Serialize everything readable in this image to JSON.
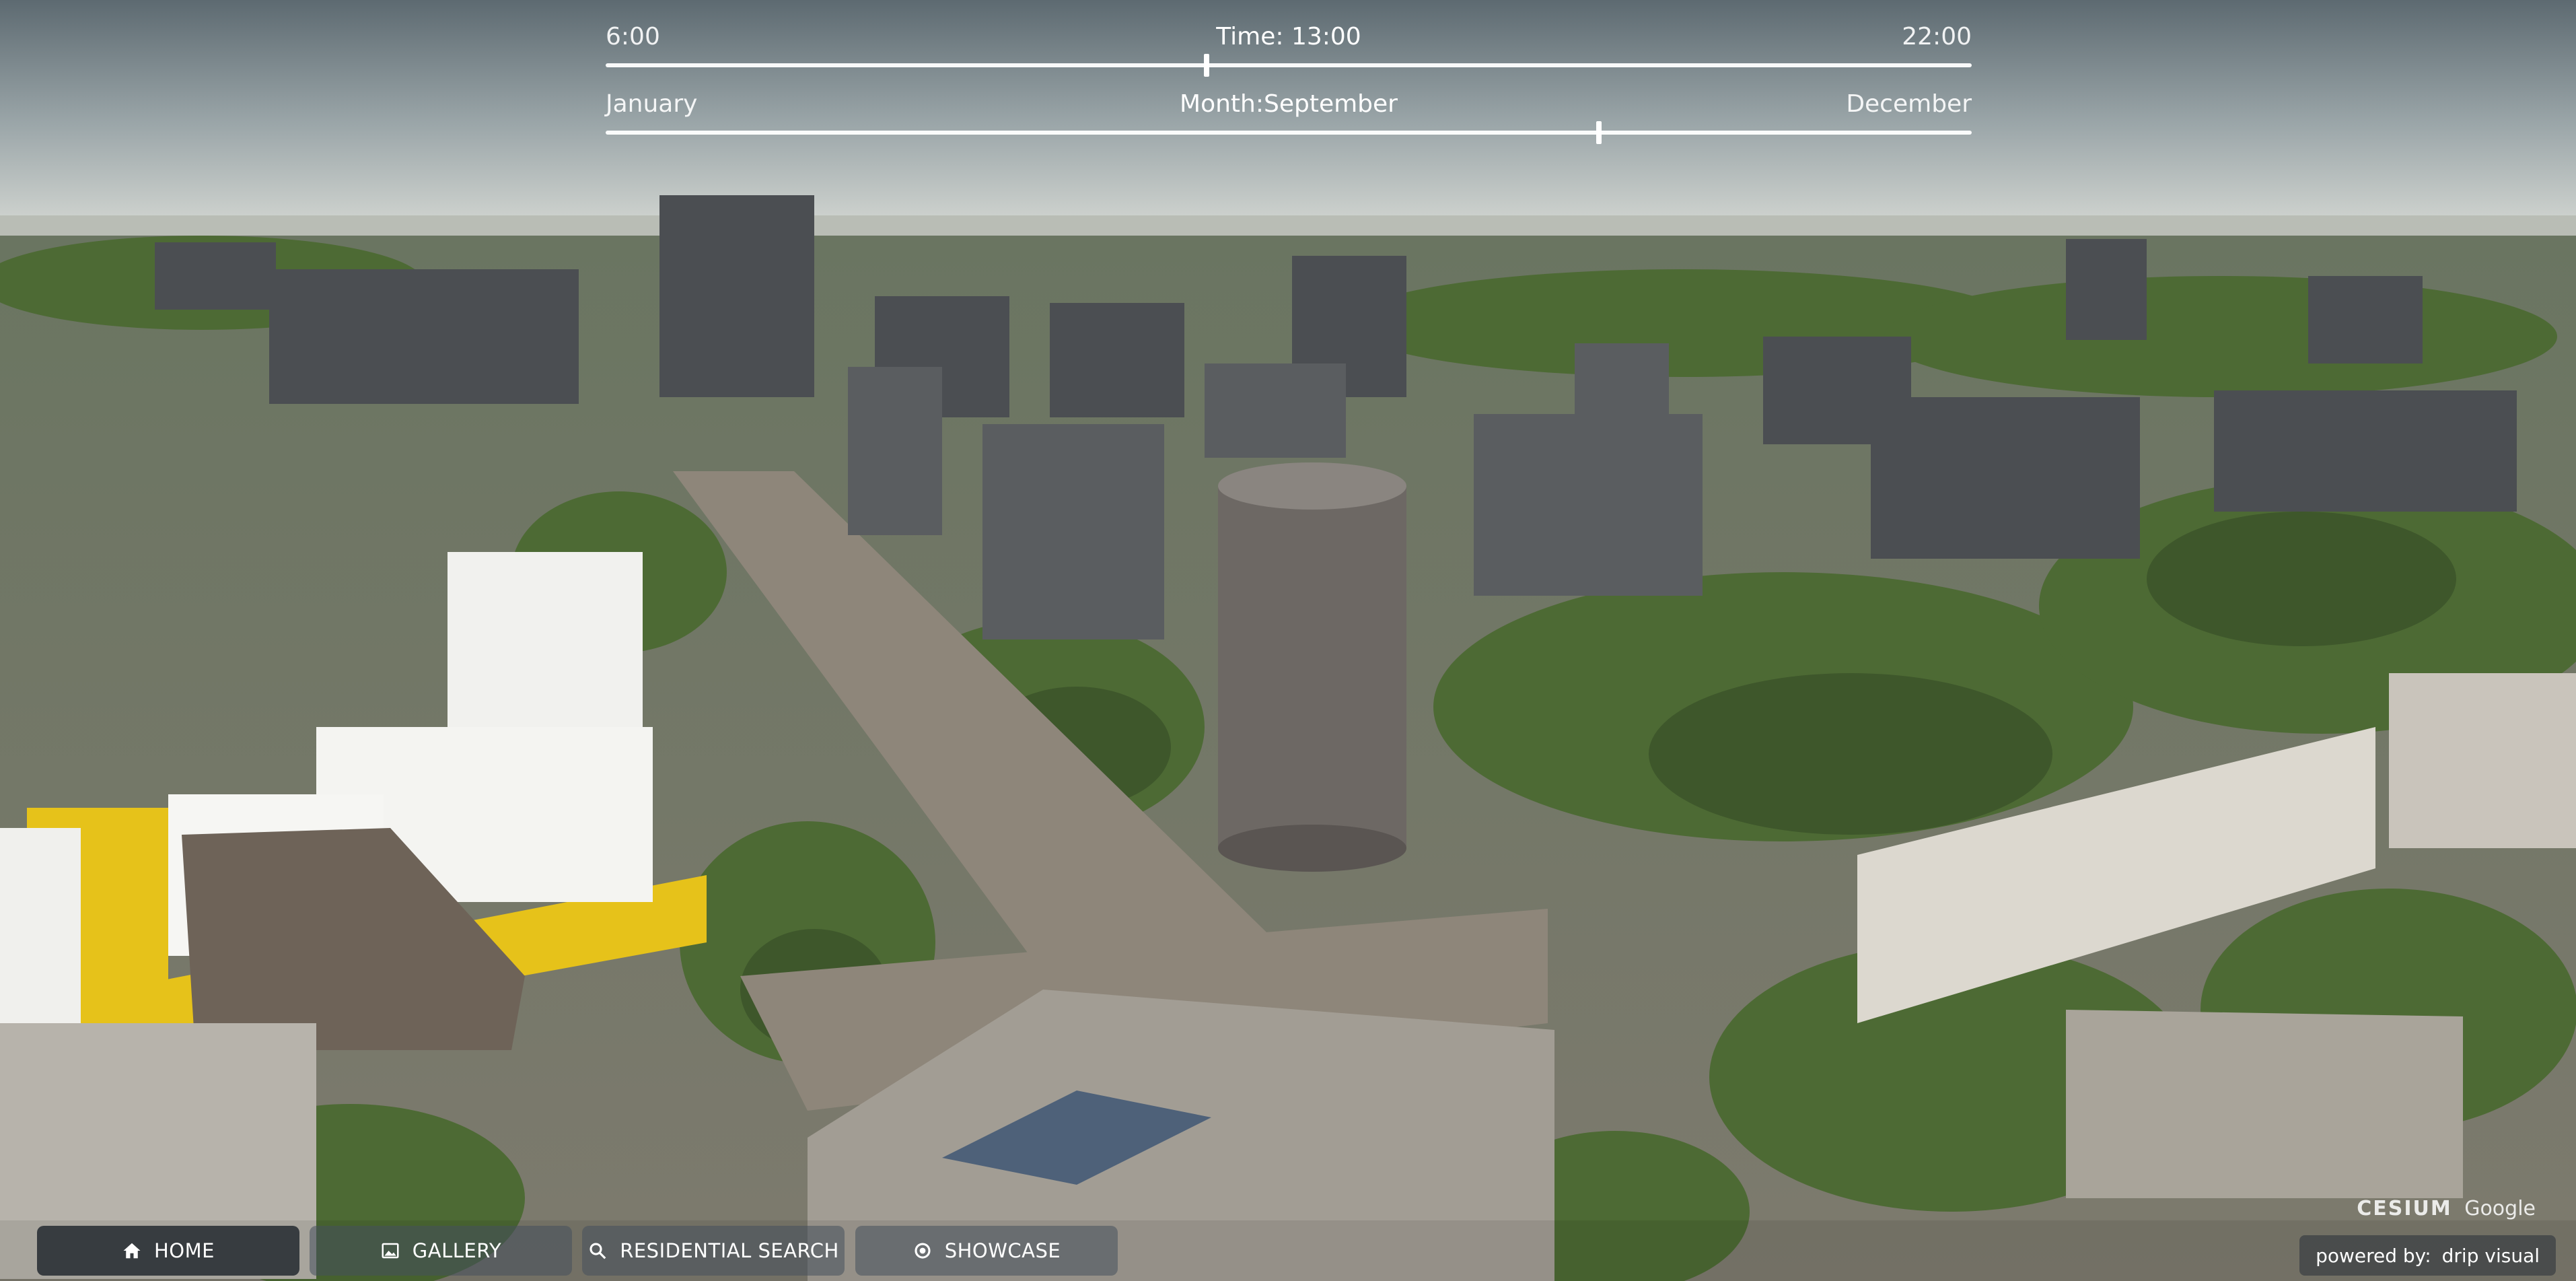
{
  "time_slider": {
    "min_label": "6:00",
    "current_label": "Time: 13:00",
    "max_label": "22:00",
    "value_fraction": 0.44
  },
  "month_slider": {
    "min_label": "January",
    "current_label": "Month:September",
    "max_label": "December",
    "value_fraction": 0.727
  },
  "nav": {
    "home": "HOME",
    "gallery": "GALLERY",
    "residential": "RESIDENTIAL SEARCH",
    "showcase": "SHOWCASE"
  },
  "attribution": {
    "cesium": "CESIUM",
    "google": "Google",
    "powered_label": "powered by:",
    "powered_brand": "drip visual"
  },
  "colors": {
    "sky_top": "#5f6b72",
    "sky_bottom": "#c3c9c8",
    "vegetation": "#4a6a35",
    "highlight_building": "#f2f2ef",
    "highlight_base": "#e6c21a"
  },
  "scene": {
    "type": "3D photorealistic city tiles viewer"
  }
}
